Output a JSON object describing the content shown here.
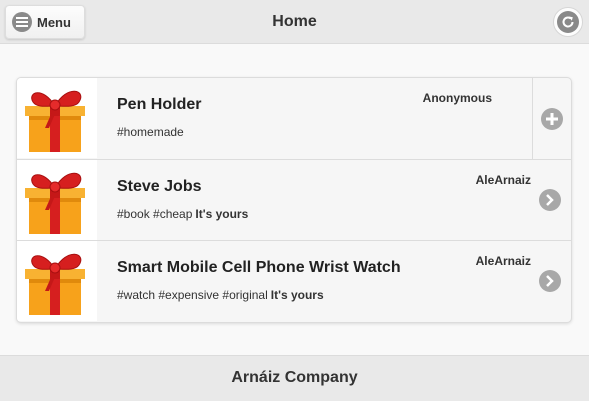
{
  "header": {
    "menu_label": "Menu",
    "menu_icon": "hamburger-icon",
    "title": "Home",
    "refresh_icon": "refresh-icon"
  },
  "items": [
    {
      "title": "Pen Holder",
      "owner": "Anonymous",
      "tags": "#homemade",
      "status": "",
      "action_icon": "plus-icon",
      "thumbnail_icon": "gift-icon"
    },
    {
      "title": "Steve Jobs",
      "owner": "AleArnaiz",
      "tags": "#book #cheap",
      "status": "It's yours",
      "action_icon": "chevron-right-icon",
      "thumbnail_icon": "gift-icon"
    },
    {
      "title": "Smart Mobile Cell Phone Wrist Watch",
      "owner": "AleArnaiz",
      "tags": "#watch #expensive #original",
      "status": "It's yours",
      "action_icon": "chevron-right-icon",
      "thumbnail_icon": "gift-icon"
    }
  ],
  "footer": {
    "text": "Arnáiz Company"
  },
  "colors": {
    "header_bg": "#e9e9e9",
    "icon_grey": "#8a8a8a",
    "gift_red": "#d61f1f",
    "gift_orange": "#f7a21b"
  }
}
